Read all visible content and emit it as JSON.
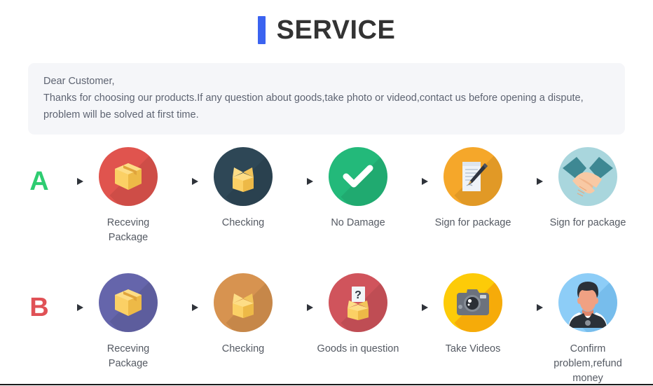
{
  "header": {
    "title": "SERVICE",
    "accent_color": "#3b63f0"
  },
  "notice": {
    "line1": "Dear Customer,",
    "line2": "Thanks for choosing our products.If any question about goods,take photo or videod,contact us before opening a dispute,",
    "line3": "problem will be solved at first time.",
    "background_color": "#f5f6f9",
    "text_color": "#5e6472"
  },
  "flows": [
    {
      "letter": "A",
      "letter_color": "#2ecc71",
      "steps": [
        {
          "label": "Receving Package",
          "icon": "closed-box-icon",
          "circle_color": "#e0544e"
        },
        {
          "label": "Checking",
          "icon": "open-box-icon",
          "circle_color": "#2e4756"
        },
        {
          "label": "No Damage",
          "icon": "check-mark-icon",
          "circle_color": "#23b97a"
        },
        {
          "label": "Sign for package",
          "icon": "document-pen-icon",
          "circle_color": "#f5a72a"
        },
        {
          "label": "Sign for package",
          "icon": "handshake-icon",
          "circle_color": "#a9d6dd"
        }
      ]
    },
    {
      "letter": "B",
      "letter_color": "#e05156",
      "steps": [
        {
          "label": "Receving Package",
          "icon": "closed-box-icon",
          "circle_color": "#6565ab"
        },
        {
          "label": "Checking",
          "icon": "open-box-icon",
          "circle_color": "#d79350"
        },
        {
          "label": "Goods in question",
          "icon": "question-box-icon",
          "circle_color": "#d0545c"
        },
        {
          "label": "Take Videos",
          "icon": "camera-icon",
          "circle_color": "#fdcb08"
        },
        {
          "label": "Confirm problem,refund money",
          "icon": "person-avatar-icon",
          "circle_color": "#8dcdf7"
        }
      ]
    }
  ],
  "arrow": {
    "name": "arrow-right-icon",
    "color": "#3c3f45"
  }
}
